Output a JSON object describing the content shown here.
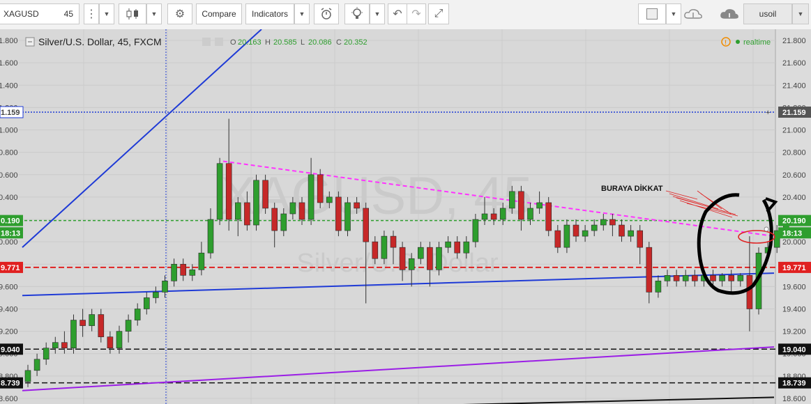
{
  "toolbar": {
    "symbol": "XAGUSD",
    "interval": "45",
    "compare_label": "Compare",
    "indicators_label": "Indicators",
    "user_label": "usoil",
    "icons": [
      "candles-icon",
      "settings-icon",
      "alert-icon",
      "idea-icon",
      "undo-icon",
      "redo-icon",
      "fullscreen-icon",
      "cloud-save-icon",
      "cloud-load-icon"
    ]
  },
  "legend": {
    "title": "Silver/U.S. Dollar, 45, FXCM",
    "o_label": "O",
    "o_value": "20.163",
    "h_label": "H",
    "h_value": "20.585",
    "l_label": "L",
    "l_value": "20.086",
    "c_label": "C",
    "c_value": "20.352",
    "realtime_label": "realtime"
  },
  "watermark": {
    "symbol": "XAGUSD, 45",
    "name": "Silver/U.S. Dollar"
  },
  "annotation": {
    "text": "BURAYA DİKKAT"
  },
  "colors": {
    "up": "#2e9e2e",
    "down": "#c62828",
    "accent": "#1e63d6"
  },
  "chart_data": {
    "type": "candlestick",
    "title": "Silver/U.S. Dollar, 45, FXCM",
    "ylim": [
      18.55,
      21.9
    ],
    "y_ticks": [
      "21.800",
      "21.600",
      "21.400",
      "21.200",
      "21.000",
      "20.800",
      "20.600",
      "20.400",
      "20.200",
      "20.000",
      "19.800",
      "19.600",
      "19.400",
      "19.200",
      "19.000",
      "18.800",
      "18.600"
    ],
    "price_tags": [
      {
        "label": "21.159",
        "value": 21.159,
        "style": "crosshair"
      },
      {
        "label": "20.190",
        "value": 20.19,
        "style": "green"
      },
      {
        "label": "18:13",
        "value": 20.08,
        "style": "countdown"
      },
      {
        "label": "19.771",
        "value": 19.771,
        "style": "red"
      },
      {
        "label": "19.040",
        "value": 19.04,
        "style": "black"
      },
      {
        "label": "18.739",
        "value": 18.739,
        "style": "black"
      }
    ],
    "horizontal_lines": [
      {
        "value": 21.159,
        "color": "#1e3ad6",
        "dash": "2,2"
      },
      {
        "value": 20.19,
        "color": "#2e9e2e",
        "dash": "4,3"
      },
      {
        "value": 19.771,
        "color": "#e02020",
        "dash": "8,4"
      },
      {
        "value": 19.04,
        "color": "#111111",
        "dash": "8,4"
      },
      {
        "value": 18.739,
        "color": "#111111",
        "dash": "8,4"
      }
    ],
    "candles": [
      [
        18.75,
        18.85,
        18.7,
        18.9
      ],
      [
        18.85,
        18.95,
        18.8,
        19.0
      ],
      [
        18.95,
        19.05,
        18.9,
        19.1
      ],
      [
        19.05,
        19.1,
        19.0,
        19.15
      ],
      [
        19.1,
        19.05,
        19.0,
        19.2
      ],
      [
        19.05,
        19.3,
        19.0,
        19.35
      ],
      [
        19.3,
        19.25,
        19.15,
        19.4
      ],
      [
        19.25,
        19.35,
        19.2,
        19.4
      ],
      [
        19.35,
        19.15,
        19.1,
        19.4
      ],
      [
        19.15,
        19.05,
        19.0,
        19.2
      ],
      [
        19.05,
        19.2,
        19.0,
        19.25
      ],
      [
        19.2,
        19.3,
        19.1,
        19.35
      ],
      [
        19.3,
        19.4,
        19.25,
        19.45
      ],
      [
        19.4,
        19.5,
        19.35,
        19.55
      ],
      [
        19.5,
        19.55,
        19.45,
        19.6
      ],
      [
        19.55,
        19.65,
        19.5,
        19.7
      ],
      [
        19.65,
        19.8,
        19.6,
        19.85
      ],
      [
        19.8,
        19.7,
        19.65,
        19.85
      ],
      [
        19.7,
        19.75,
        19.65,
        19.8
      ],
      [
        19.75,
        19.9,
        19.7,
        20.0
      ],
      [
        19.9,
        20.2,
        19.85,
        20.3
      ],
      [
        20.2,
        20.7,
        20.15,
        20.75
      ],
      [
        20.7,
        20.2,
        20.1,
        21.1
      ],
      [
        20.2,
        20.35,
        20.05,
        20.4
      ],
      [
        20.35,
        20.15,
        20.1,
        20.45
      ],
      [
        20.15,
        20.55,
        20.1,
        20.6
      ],
      [
        20.55,
        20.3,
        20.25,
        20.6
      ],
      [
        20.3,
        20.1,
        19.95,
        20.35
      ],
      [
        20.1,
        20.25,
        20.05,
        20.3
      ],
      [
        20.25,
        20.35,
        20.2,
        20.4
      ],
      [
        20.35,
        20.2,
        20.15,
        20.4
      ],
      [
        20.2,
        20.6,
        20.15,
        20.75
      ],
      [
        20.6,
        20.35,
        20.3,
        20.65
      ],
      [
        20.35,
        20.4,
        20.3,
        20.45
      ],
      [
        20.4,
        20.1,
        20.05,
        20.45
      ],
      [
        20.1,
        20.35,
        20.05,
        20.4
      ],
      [
        20.35,
        20.3,
        20.25,
        20.4
      ],
      [
        20.3,
        20.0,
        19.45,
        20.35
      ],
      [
        20.0,
        19.85,
        19.8,
        20.05
      ],
      [
        19.85,
        20.05,
        19.8,
        20.1
      ],
      [
        20.05,
        19.95,
        19.8,
        20.1
      ],
      [
        19.95,
        19.75,
        19.65,
        20.0
      ],
      [
        19.75,
        19.85,
        19.6,
        19.9
      ],
      [
        19.85,
        19.95,
        19.8,
        20.0
      ],
      [
        19.95,
        19.75,
        19.6,
        20.0
      ],
      [
        19.75,
        19.95,
        19.7,
        20.0
      ],
      [
        19.95,
        20.0,
        19.9,
        20.05
      ],
      [
        20.0,
        19.9,
        19.85,
        20.05
      ],
      [
        19.9,
        20.0,
        19.85,
        20.05
      ],
      [
        20.0,
        20.2,
        19.95,
        20.25
      ],
      [
        20.2,
        20.25,
        20.15,
        20.4
      ],
      [
        20.25,
        20.2,
        20.15,
        20.3
      ],
      [
        20.2,
        20.3,
        20.15,
        20.35
      ],
      [
        20.3,
        20.45,
        20.25,
        20.5
      ],
      [
        20.45,
        20.2,
        20.1,
        20.5
      ],
      [
        20.2,
        20.3,
        20.15,
        20.35
      ],
      [
        20.3,
        20.35,
        20.25,
        20.45
      ],
      [
        20.35,
        20.1,
        20.05,
        20.4
      ],
      [
        20.1,
        19.95,
        19.9,
        20.15
      ],
      [
        19.95,
        20.15,
        19.9,
        20.2
      ],
      [
        20.15,
        20.05,
        20.0,
        20.2
      ],
      [
        20.05,
        20.1,
        20.0,
        20.15
      ],
      [
        20.1,
        20.15,
        20.05,
        20.2
      ],
      [
        20.15,
        20.2,
        20.1,
        20.25
      ],
      [
        20.2,
        20.15,
        20.05,
        20.25
      ],
      [
        20.15,
        20.05,
        20.0,
        20.2
      ],
      [
        20.05,
        20.1,
        20.0,
        20.15
      ],
      [
        20.1,
        19.95,
        19.8,
        20.15
      ],
      [
        19.95,
        19.55,
        19.45,
        20.0
      ],
      [
        19.55,
        19.65,
        19.5,
        19.7
      ],
      [
        19.65,
        19.7,
        19.6,
        19.75
      ],
      [
        19.7,
        19.65,
        19.6,
        19.75
      ],
      [
        19.65,
        19.7,
        19.6,
        19.75
      ],
      [
        19.7,
        19.65,
        19.6,
        19.75
      ],
      [
        19.65,
        19.7,
        19.6,
        19.72
      ],
      [
        19.7,
        19.65,
        19.6,
        19.75
      ],
      [
        19.65,
        19.7,
        19.6,
        19.72
      ],
      [
        19.7,
        19.65,
        19.55,
        19.75
      ],
      [
        19.65,
        19.7,
        19.6,
        19.72
      ],
      [
        19.7,
        19.4,
        19.2,
        20.05
      ],
      [
        19.4,
        19.9,
        19.35,
        19.95
      ],
      [
        19.9,
        19.95,
        19.85,
        20.0
      ],
      [
        19.95,
        20.1,
        19.9,
        20.15
      ],
      [
        20.1,
        20.15,
        20.05,
        20.2
      ]
    ],
    "trendlines": [
      {
        "name": "rising-blue",
        "color": "#1e3ad6",
        "from": [
          0,
          19.95
        ],
        "to": [
          23,
          21.2
        ]
      },
      {
        "name": "support-blue",
        "color": "#1e3ad6",
        "from": [
          0,
          19.52
        ],
        "to": [
          83,
          19.72
        ]
      },
      {
        "name": "resistance-magenta",
        "color": "#ff33ff",
        "from": [
          19,
          20.72
        ],
        "to": [
          82,
          20.05
        ],
        "dash": "6,4"
      },
      {
        "name": "purple-channel",
        "color": "#9b1ee6",
        "from": [
          0,
          18.67
        ],
        "to": [
          83,
          19.06
        ]
      },
      {
        "name": "black-bottom",
        "color": "#111111",
        "from": [
          0,
          18.45
        ],
        "to": [
          83,
          18.61
        ]
      }
    ],
    "grid": true
  }
}
